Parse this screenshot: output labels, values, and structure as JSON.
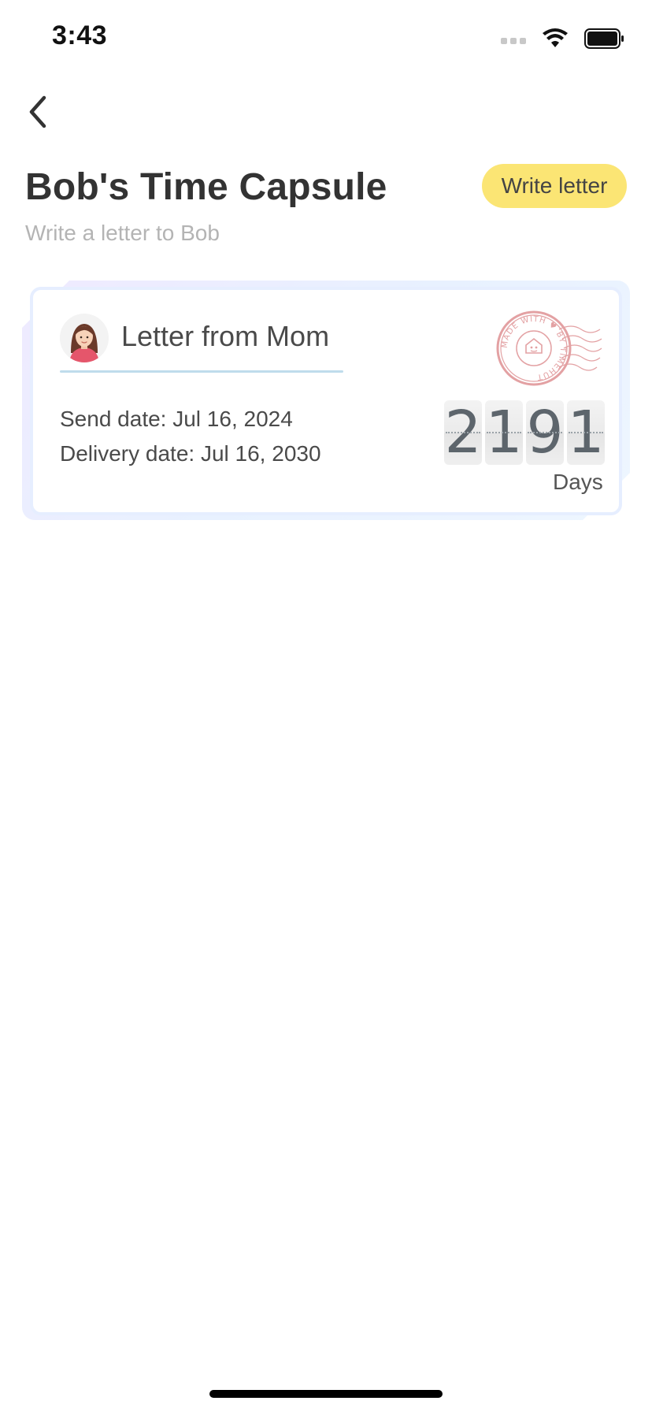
{
  "status_bar": {
    "time": "3:43",
    "icons": [
      "signal-icon",
      "wifi-icon",
      "battery-icon"
    ]
  },
  "nav": {
    "back_icon": "chevron-left-icon"
  },
  "header": {
    "title": "Bob's Time Capsule",
    "subtitle": "Write a letter to Bob",
    "write_button_label": "Write letter"
  },
  "letters": [
    {
      "title": "Letter from Mom",
      "send_date": "Send date: Jul 16, 2024",
      "delivery_date": "Delivery date: Jul 16, 2030",
      "days_remaining_digits": [
        "2",
        "1",
        "9",
        "1"
      ],
      "days_label": "Days",
      "stamp_text": "MADE WITH ♥ BY TIMEHUT",
      "avatar": "mom-avatar"
    }
  ],
  "colors": {
    "accent_button": "#fbe574",
    "underline": "#bfdcec",
    "stamp": "#e3a1a3"
  }
}
